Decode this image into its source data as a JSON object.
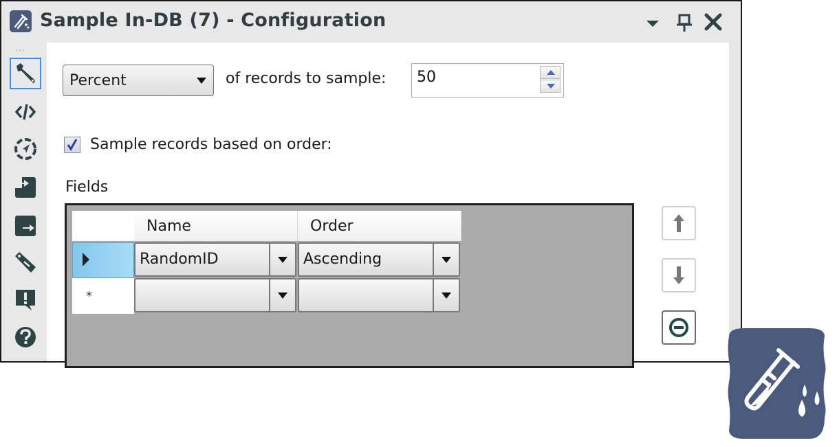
{
  "window": {
    "title": "Sample In-DB (7)  - Configuration",
    "title_buttons": [
      "dropdown-arrow-icon",
      "pin-icon",
      "close-icon"
    ]
  },
  "sidebar": {
    "overflow_label": "...",
    "items": [
      {
        "icon": "wrench-icon",
        "name": "configuration",
        "active": true
      },
      {
        "icon": "code-icon",
        "name": "xml-view",
        "active": false
      },
      {
        "icon": "compass-icon",
        "name": "navigation",
        "active": false
      },
      {
        "icon": "input-icon",
        "name": "input",
        "active": false
      },
      {
        "icon": "output-icon",
        "name": "output",
        "active": false
      },
      {
        "icon": "tag-icon",
        "name": "annotation",
        "active": false
      },
      {
        "icon": "alert-icon",
        "name": "errors",
        "active": false
      },
      {
        "icon": "help-icon",
        "name": "help",
        "active": false
      }
    ]
  },
  "config": {
    "mode_select": {
      "value": "Percent"
    },
    "records_label": "of records to sample:",
    "records_value": "50",
    "order_checkbox": {
      "label": "Sample records based on order:",
      "checked": true
    },
    "fields_label": "Fields",
    "table": {
      "columns": [
        "Name",
        "Order"
      ],
      "rows": [
        {
          "indicator": "current-row-arrow",
          "name": "RandomID",
          "order": "Ascending"
        },
        {
          "indicator": "*",
          "name": "",
          "order": ""
        }
      ]
    },
    "actions": [
      "move-up",
      "move-down",
      "remove"
    ]
  },
  "colors": {
    "accent_icon_bg": "#4a5a7c",
    "icon_dark": "#2d4447",
    "selected_row": "#9ad6f4",
    "active_outline": "#3d8ee6"
  }
}
